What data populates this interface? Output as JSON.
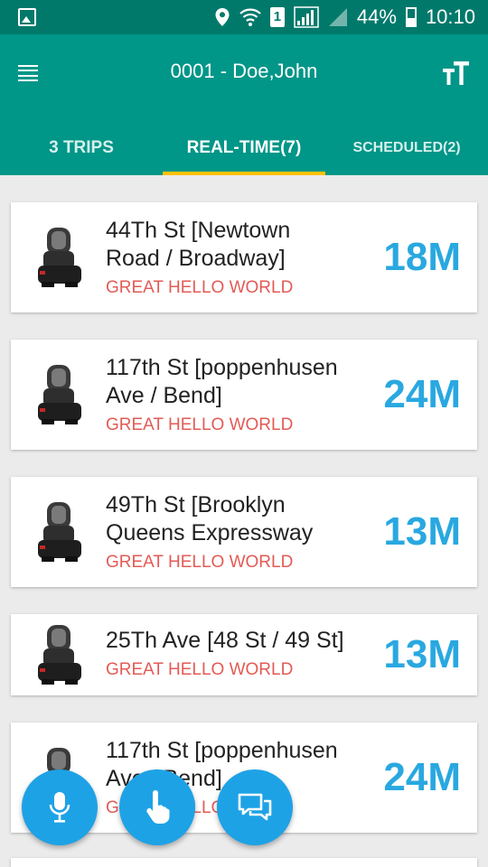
{
  "status_bar": {
    "battery": "44%",
    "sim": "1",
    "time": "10:10",
    "icons": [
      "image-icon",
      "location-icon",
      "wifi-icon",
      "signal-icon",
      "battery-icon"
    ]
  },
  "app_bar": {
    "title": "0001 - Doe,John",
    "icons": [
      "menu-icon",
      "text-size-icon"
    ]
  },
  "tabs": [
    {
      "label": "3 TRIPS",
      "selected": false
    },
    {
      "label": "REAL-TIME(7)",
      "selected": true
    },
    {
      "label": "SCHEDULED(2)",
      "selected": false
    }
  ],
  "stops": [
    {
      "name_line1": "44Th St [Newtown",
      "name_line2": "Road / Broadway]",
      "route": "GREAT HELLO WORLD",
      "eta": "18M"
    },
    {
      "name_line1": "117th St [poppenhusen",
      "name_line2": "Ave / Bend]",
      "route": "GREAT HELLO WORLD",
      "eta": "24M"
    },
    {
      "name_line1": "49Th St [Brooklyn",
      "name_line2": "Queens Expressway",
      "route": "GREAT HELLO WORLD",
      "eta": "13M"
    },
    {
      "name_line1": "25Th Ave [48 St / 49 St]",
      "name_line2": "",
      "route": "GREAT HELLO WORLD",
      "eta": "13M"
    },
    {
      "name_line1": "117th St [poppenhusen",
      "name_line2": "Ave / Bend]",
      "route": "GREAT HELLO WORLD",
      "eta": "24M"
    }
  ],
  "fabs": [
    "microphone-icon",
    "touch-icon",
    "chat-icon"
  ],
  "colors": {
    "status_bar": "#00796b",
    "app_bar": "#009688",
    "tab_indicator": "#ffc107",
    "eta": "#29a8e0",
    "route": "#e35b55",
    "fab": "#1ea2e6"
  }
}
